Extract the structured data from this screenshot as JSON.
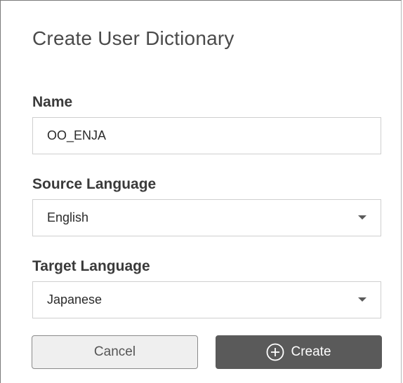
{
  "dialog": {
    "title": "Create User Dictionary"
  },
  "form": {
    "name": {
      "label": "Name",
      "value": "OO_ENJA"
    },
    "source_language": {
      "label": "Source Language",
      "selected": "English"
    },
    "target_language": {
      "label": "Target Language",
      "selected": "Japanese"
    }
  },
  "actions": {
    "cancel_label": "Cancel",
    "create_label": "Create",
    "create_icon": "plus-circle-icon"
  },
  "colors": {
    "primary_button": "#5a5a5a",
    "secondary_button": "#efefef",
    "field_border": "#cfcfcf"
  }
}
